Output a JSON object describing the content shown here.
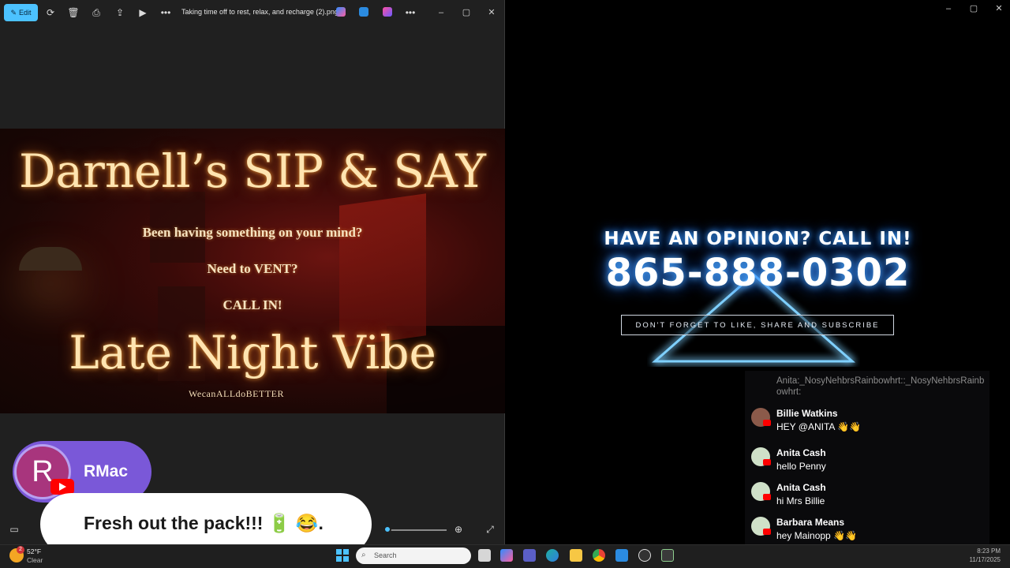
{
  "viewer": {
    "edit_label": "Edit",
    "file_title": "Taking time off to rest, relax, and recharge (2).png",
    "more_label": "•••",
    "window_controls": [
      "–",
      "▢",
      "✕"
    ]
  },
  "poster": {
    "title": "Darnell’s SIP & SAY",
    "line1": "Been having something on your mind?",
    "line2": "Need to VENT?",
    "line3": "CALL IN!",
    "subtitle": "Late Night Vibe",
    "hashtag": "WecanALLdoBETTER"
  },
  "stream": {
    "headline": "HAVE AN OPINION? CALL IN!",
    "phone": "865-888-0302",
    "cta": "DON'T FORGET TO LIKE, SHARE AND SUBSCRIBE",
    "window_controls": [
      "–",
      "▢",
      "✕"
    ]
  },
  "chat": {
    "top_fragment": "Anita:_NosyNehbrsRainbowhrt::_NosyNehbrsRainbowhrt:",
    "messages": [
      {
        "name": "Billie Watkins",
        "text": "HEY @ANITA 👋👋"
      },
      {
        "name": "Anita Cash",
        "text": "hello Penny"
      },
      {
        "name": "Anita Cash",
        "text": "hi Mrs Billie"
      },
      {
        "name": "Barbara Means",
        "text": "hey Mainopp 👋👋"
      }
    ]
  },
  "overlay": {
    "avatar_letter": "R",
    "username": "RMac",
    "message": "Fresh out the pack!!! 🔋 😂."
  },
  "taskbar": {
    "weather_badge": "2",
    "weather_temp": "52°F",
    "weather_desc": "Clear",
    "search_placeholder": "Search",
    "time": "8:23 PM",
    "date": "11/17/2025"
  },
  "colors": {
    "accent": "#4cc2ff",
    "neon_blue": "#3da2ff",
    "rmac_purple": "#7a58d8",
    "youtube_red": "#ff0000"
  }
}
